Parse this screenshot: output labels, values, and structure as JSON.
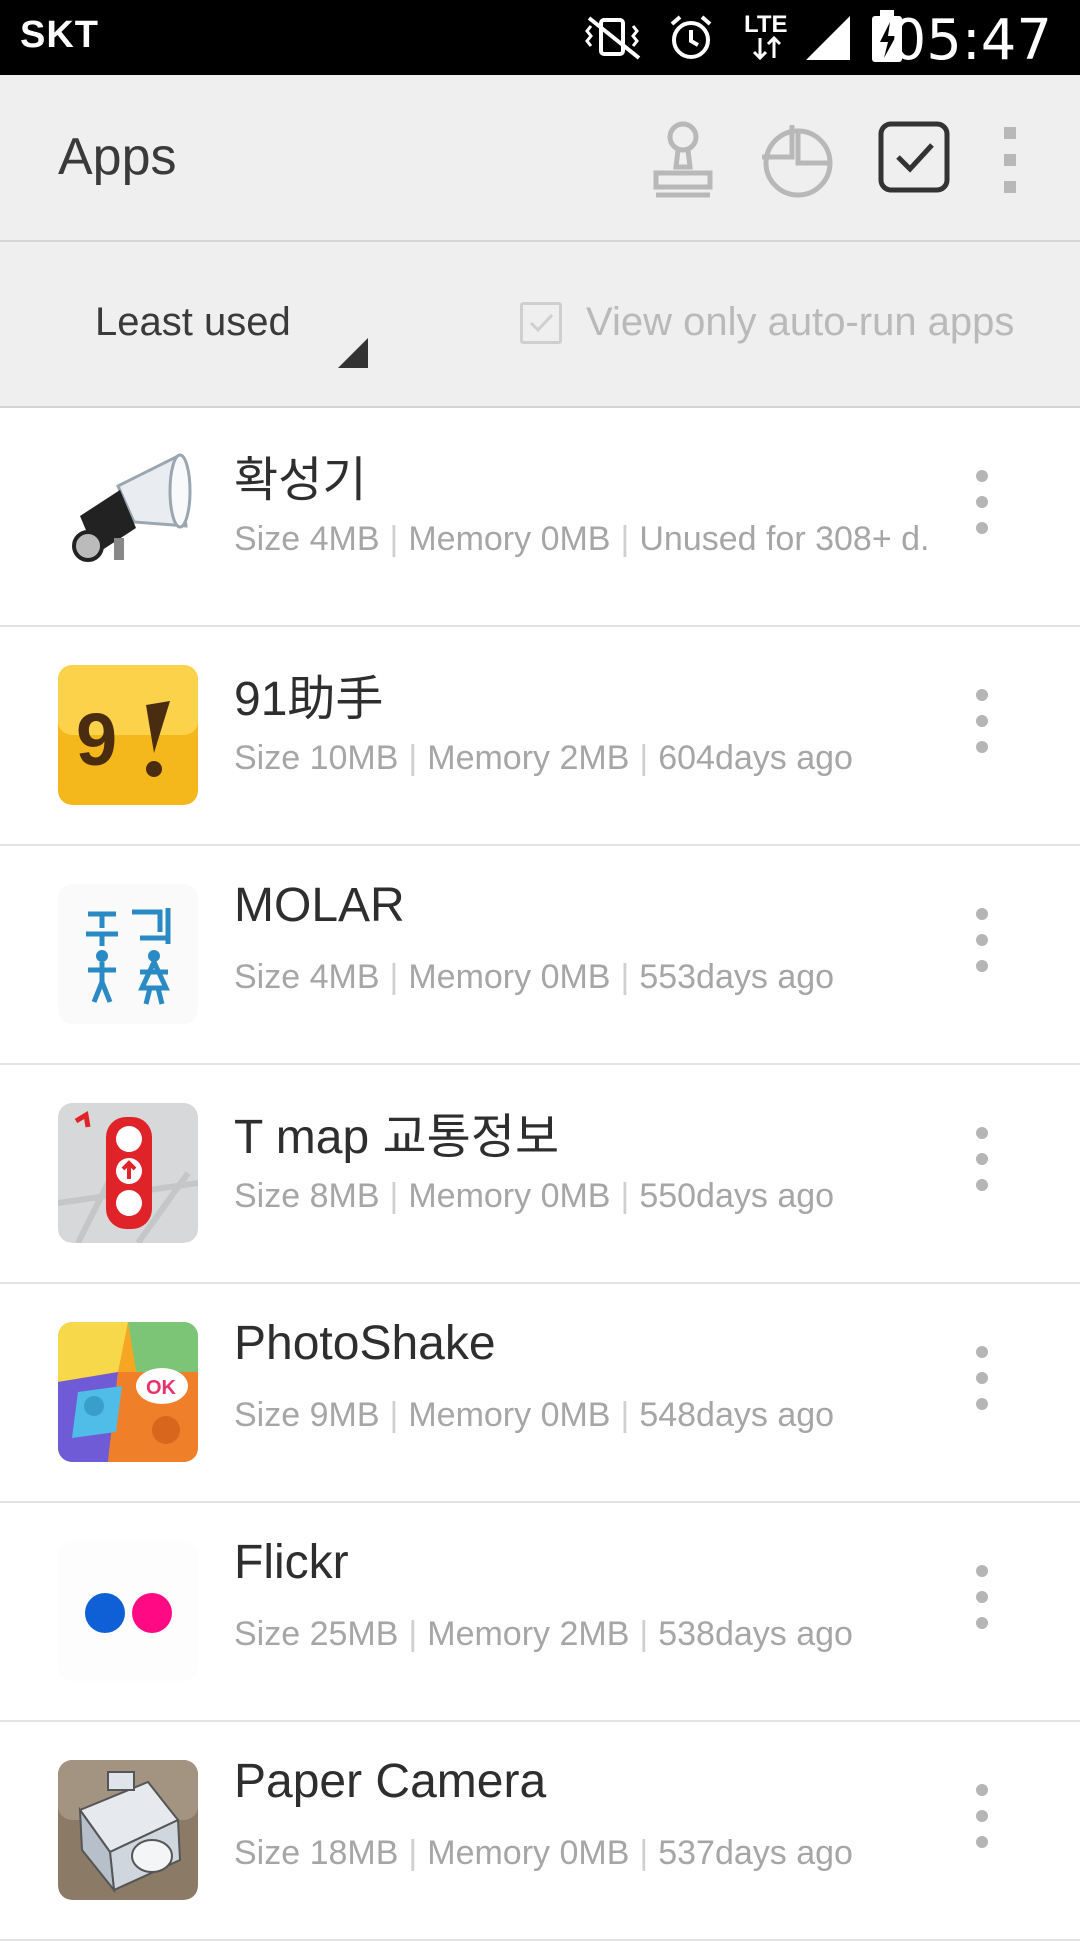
{
  "status_bar": {
    "carrier": "SKT",
    "network": "LTE",
    "time": "05:47",
    "icons": [
      "vibrate-mute-icon",
      "alarm-icon",
      "lte-icon",
      "signal-icon",
      "battery-charging-icon"
    ]
  },
  "action_bar": {
    "title": "Apps",
    "actions": [
      "clean-brush-icon",
      "pie-chart-icon",
      "select-checkbox-icon",
      "overflow-menu-icon"
    ]
  },
  "filter": {
    "sort_label": "Least used",
    "autorun_label": "View only auto-run apps",
    "autorun_checked": true
  },
  "apps": [
    {
      "name": "확성기",
      "size": "Size 4MB",
      "memory": "Memory 0MB",
      "usage": "Unused for 308+ d.",
      "icon": "megaphone-icon"
    },
    {
      "name": "91助手",
      "size": "Size 10MB",
      "memory": "Memory 2MB",
      "usage": "604days ago",
      "icon": "91-assistant-icon"
    },
    {
      "name": "MOLAR",
      "size": "Size 4MB",
      "memory": "Memory 0MB",
      "usage": "553days ago",
      "icon": "molar-icon"
    },
    {
      "name": "T map 교통정보",
      "size": "Size 8MB",
      "memory": "Memory 0MB",
      "usage": "550days ago",
      "icon": "traffic-light-icon"
    },
    {
      "name": "PhotoShake",
      "size": "Size 9MB",
      "memory": "Memory 0MB",
      "usage": "548days ago",
      "icon": "photoshake-icon"
    },
    {
      "name": "Flickr",
      "size": "Size 25MB",
      "memory": "Memory 2MB",
      "usage": "538days ago",
      "icon": "flickr-icon"
    },
    {
      "name": "Paper Camera",
      "size": "Size 18MB",
      "memory": "Memory 0MB",
      "usage": "537days ago",
      "icon": "paper-camera-icon"
    }
  ],
  "colors": {
    "status_bar_bg": "#000000",
    "header_bg": "#efefef",
    "text_primary": "#2e2e2e",
    "text_secondary": "#a6a6a6"
  }
}
